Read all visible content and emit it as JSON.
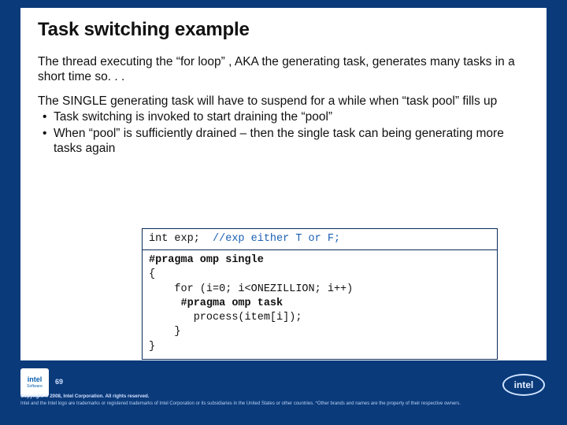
{
  "slide": {
    "title": "Task switching example",
    "para1": "The thread executing the “for loop” , AKA the generating task, generates many tasks in a short time so. . .",
    "para2": "The SINGLE generating task will have to suspend for a while when “task pool” fills up",
    "bullets": [
      "Task switching is invoked to start draining the “pool”",
      "When “pool” is sufficiently drained – then the single task can being generating more tasks again"
    ],
    "code": {
      "decl": "int exp;",
      "comment": "//exp either T or F;",
      "pragma_single": "#pragma omp single",
      "open1": "{",
      "for": "    for (i=0; i<ONEZILLION; i++)",
      "pragma_task": "     #pragma omp task",
      "call": "       process(item[i]);",
      "close1": "    }",
      "close2": "}"
    }
  },
  "footer": {
    "page": "69",
    "badge": {
      "word1": "intel",
      "word2": "Software"
    },
    "logo": "intel",
    "copyright": "Copyright © 2008, Intel Corporation. All rights reserved.",
    "legal": "Intel and the Intel logo are trademarks or registered trademarks of Intel Corporation or its subsidiaries in the United States or other countries. *Other brands and names are the property of their respective owners."
  }
}
